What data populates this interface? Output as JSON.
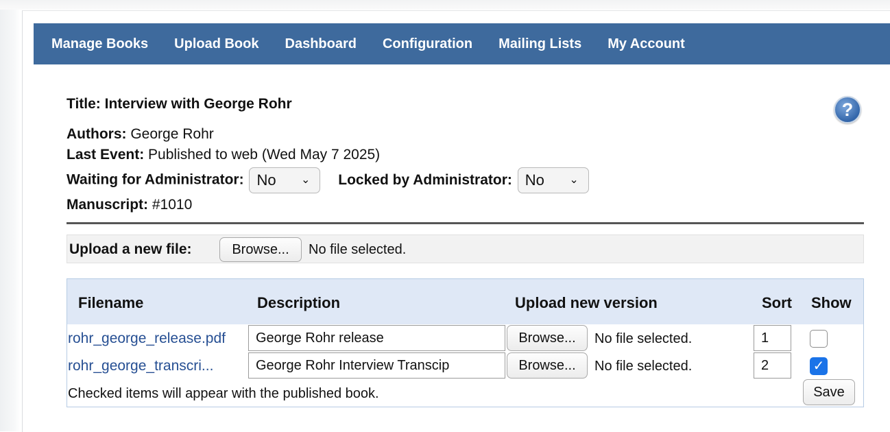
{
  "nav": {
    "items": [
      "Manage Books",
      "Upload Book",
      "Dashboard",
      "Configuration",
      "Mailing Lists",
      "My Account"
    ],
    "color": "#3e6a9d"
  },
  "book": {
    "title_label": "Title: Interview with George Rohr",
    "authors_label": "Authors:",
    "authors_value": "George Rohr",
    "last_event_label": "Last Event:",
    "last_event_value": "Published to web (Wed May 7 2025)",
    "waiting_label": "Waiting for Administrator:",
    "waiting_value": "No",
    "locked_label": "Locked by Administrator:",
    "locked_value": "No",
    "manuscript_label": "Manuscript:",
    "manuscript_value": "#1010"
  },
  "upload": {
    "label": "Upload a new file:",
    "browse": "Browse...",
    "status": "No file selected."
  },
  "table": {
    "headers": [
      "Filename",
      "Description",
      "Upload new version",
      "Sort",
      "Show"
    ],
    "rows": [
      {
        "filename": "rohr_george_release.pdf",
        "description": "George Rohr release",
        "browse": "Browse...",
        "status": "No file selected.",
        "sort": "1",
        "show": false
      },
      {
        "filename": "rohr_george_transcri...",
        "description": "George Rohr Interview Transcip",
        "browse": "Browse...",
        "status": "No file selected.",
        "sort": "2",
        "show": true
      }
    ],
    "footer_note": "Checked items will appear with the published book.",
    "save": "Save"
  },
  "icons": {
    "help": "help-question-icon",
    "chevron": "chevron-down-icon",
    "check": "checkmark-icon"
  }
}
